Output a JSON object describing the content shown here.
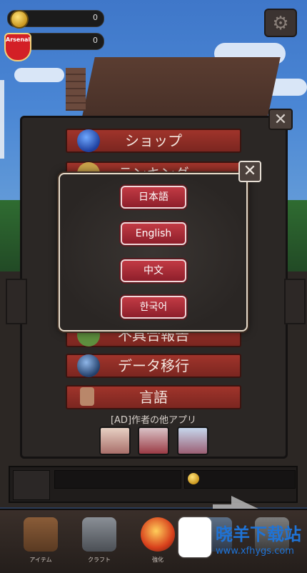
{
  "hud": {
    "coin_value": "0",
    "secondary_value": "0",
    "team_badge_text": "Arsenal"
  },
  "menu": {
    "items": [
      {
        "label": "ショップ",
        "icon": "globe-icon"
      },
      {
        "label": "ランキング",
        "icon": "trophy-icon"
      },
      {
        "label": "不具合報告",
        "icon": "bug-icon"
      },
      {
        "label": "データ移行",
        "icon": "transfer-icon"
      },
      {
        "label": "言語",
        "icon": "language-icon"
      }
    ],
    "ad_label": "[AD]作者の他アプリ",
    "ad_apps": [
      "app-thumb-1",
      "app-thumb-2",
      "app-thumb-3"
    ]
  },
  "language_dialog": {
    "options": [
      "日本語",
      "English",
      "中文",
      "한국어"
    ],
    "close_icon": "close-icon"
  },
  "bottom_nav": {
    "items": [
      {
        "label": "アイテム",
        "icon": "chest-icon"
      },
      {
        "label": "クラフト",
        "icon": "hammer-icon"
      },
      {
        "label": "強化",
        "icon": "fire-orb-icon"
      },
      {
        "label": "",
        "icon": "monster-icon"
      },
      {
        "label": "",
        "icon": "viking-icon"
      }
    ]
  },
  "watermark": {
    "text": "晓羊下载站",
    "url": "www.xfhygs.com"
  }
}
